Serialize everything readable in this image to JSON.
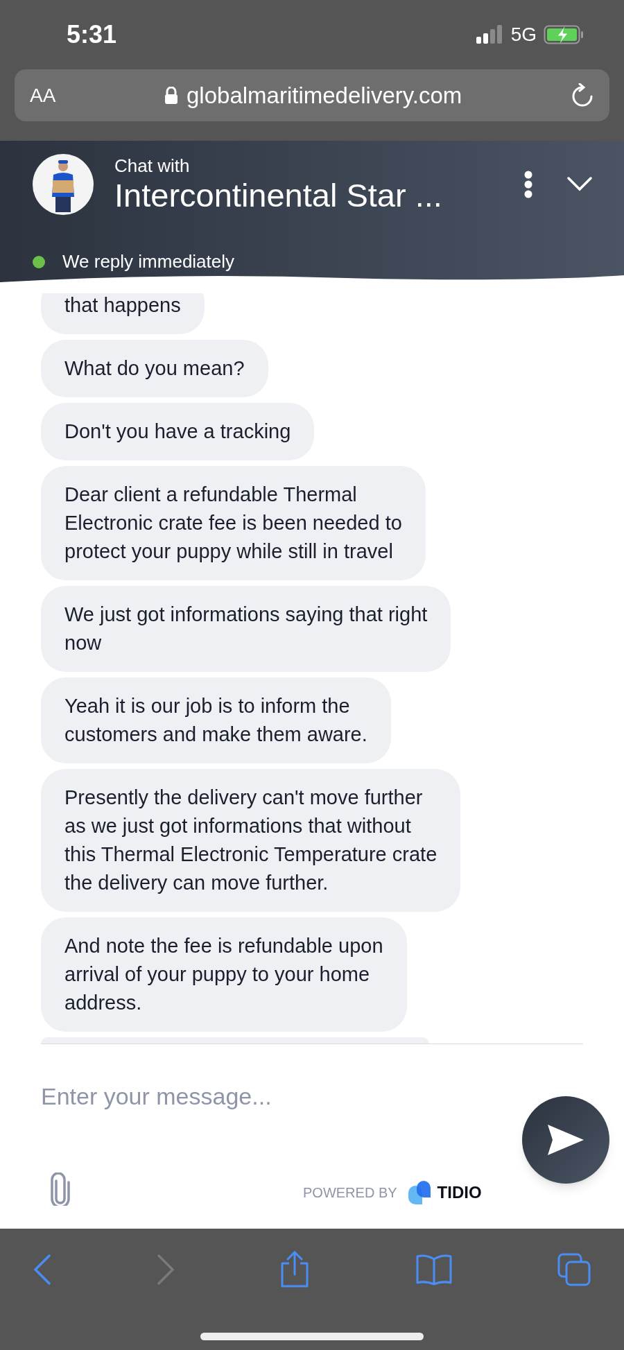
{
  "status_bar": {
    "time": "5:31",
    "network": "5G",
    "charging": true
  },
  "browser": {
    "text_size_button": "AA",
    "url": "globalmaritimedelivery.com",
    "secure": true
  },
  "chat_header": {
    "subtitle": "Chat with",
    "title": "Intercontinental Star ...",
    "status": "We reply immediately",
    "online": true
  },
  "messages": [
    {
      "text": "that happens"
    },
    {
      "text": "What do you mean?"
    },
    {
      "text": "Don't you have a tracking"
    },
    {
      "text": "Dear client a refundable Thermal\nElectronic crate fee is been needed to\nprotect your puppy while still in travel"
    },
    {
      "text": "We just got informations saying that right\nnow"
    },
    {
      "text": "Yeah it is our job is to inform the\ncustomers and make them aware."
    },
    {
      "text": "Presently the delivery can't move further\nas we just got informations that without\nthis Thermal Electronic Temperature crate\nthe delivery can move further."
    },
    {
      "text": "And note the fee is refundable upon\narrival of your puppy to your home\naddress."
    }
  ],
  "composer": {
    "placeholder": "Enter your message...",
    "powered_by": "POWERED BY",
    "brand": "TIDIO"
  }
}
